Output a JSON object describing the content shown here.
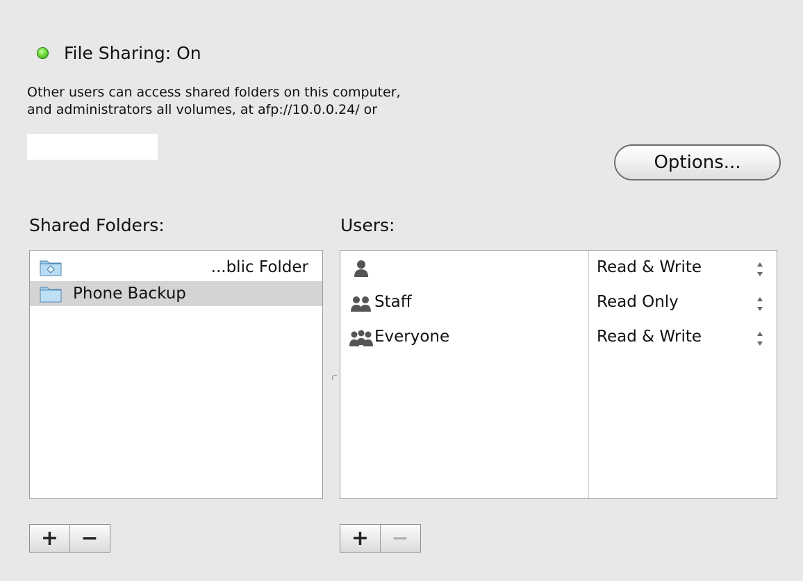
{
  "status": {
    "label": "File Sharing: On",
    "color": "#5fcf2f"
  },
  "description": {
    "line1": "Other users can access shared folders on this computer,",
    "line2": "and administrators all volumes, at afp://10.0.0.24/ or"
  },
  "options_button": {
    "label": "Options..."
  },
  "shared_folders": {
    "label": "Shared Folders:",
    "items": [
      {
        "name": "...blic Folder",
        "icon": "public-folder-icon",
        "selected": false
      },
      {
        "name": "Phone Backup",
        "icon": "folder-icon",
        "selected": true
      }
    ],
    "add_label": "+",
    "remove_label": "−"
  },
  "users": {
    "label": "Users:",
    "items": [
      {
        "name": "",
        "icon": "single-user-icon",
        "permission": "Read & Write"
      },
      {
        "name": "Staff",
        "icon": "group-icon",
        "permission": "Read Only"
      },
      {
        "name": "Everyone",
        "icon": "everyone-icon",
        "permission": "Read & Write"
      }
    ],
    "add_label": "+",
    "remove_label": "−"
  }
}
